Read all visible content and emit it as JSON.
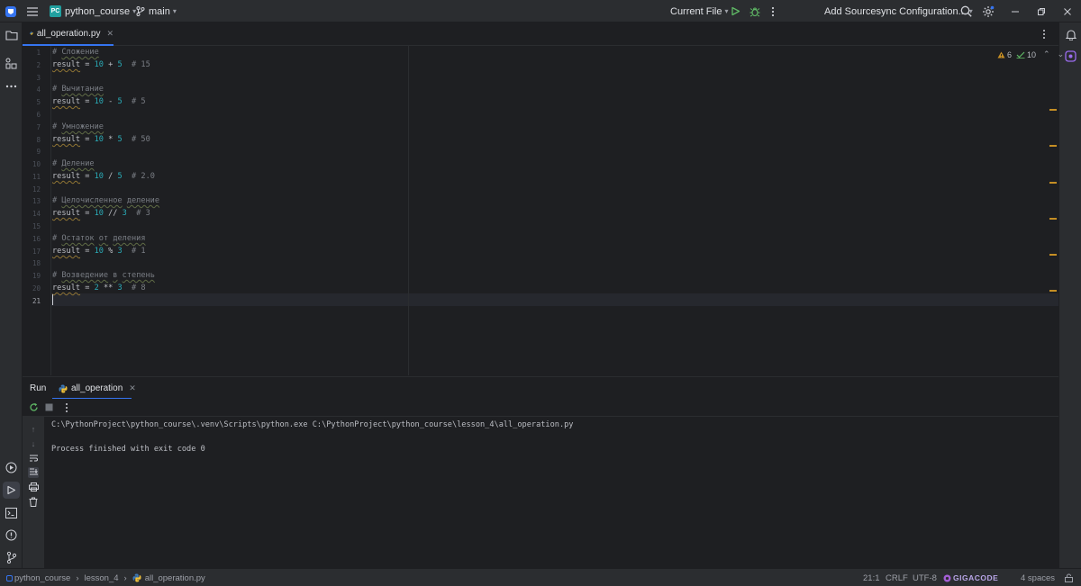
{
  "titlebar": {
    "project_badge": "PC",
    "project_name": "python_course",
    "branch": "main",
    "run_config": "Current File",
    "sourcesync": "Add Sourcesync Configuration..."
  },
  "editor_tab": {
    "filename": "all_operation.py"
  },
  "inspections": {
    "warnings": "6",
    "weak_warnings": "10"
  },
  "code_lines": [
    {
      "n": "1"
    },
    {
      "n": "2"
    },
    {
      "n": "3"
    },
    {
      "n": "4"
    },
    {
      "n": "5"
    },
    {
      "n": "6"
    },
    {
      "n": "7"
    },
    {
      "n": "8"
    },
    {
      "n": "9"
    },
    {
      "n": "10"
    },
    {
      "n": "11"
    },
    {
      "n": "12"
    },
    {
      "n": "13"
    },
    {
      "n": "14"
    },
    {
      "n": "15"
    },
    {
      "n": "16"
    },
    {
      "n": "17"
    },
    {
      "n": "18"
    },
    {
      "n": "19"
    },
    {
      "n": "20"
    },
    {
      "n": "21"
    }
  ],
  "code": {
    "c1": "Сложение",
    "c4": "Вычитание",
    "c7": "Умножение",
    "c10": "Деление",
    "c13a": "Целочисленное",
    "c13b": "деление",
    "c16a": "Остаток",
    "c16b": "от",
    "c16c": "деления",
    "c19a": "Возведение",
    "c19b": "в",
    "c19c": "степень",
    "var": "result",
    "add": {
      "a": "10",
      "op": "+",
      "b": "5",
      "res": "# 15"
    },
    "sub": {
      "a": "10",
      "op": "-",
      "b": "5",
      "res": "# 5"
    },
    "mul": {
      "a": "10",
      "op": "*",
      "b": "5",
      "res": "# 50"
    },
    "div": {
      "a": "10",
      "op": "/",
      "b": "5",
      "res": "# 2.0"
    },
    "fdiv": {
      "a": "10",
      "op": "//",
      "b": "3",
      "res": "# 3"
    },
    "mod": {
      "a": "10",
      "op": "%",
      "b": "3",
      "res": "# 1"
    },
    "pow": {
      "a": "2",
      "op": "**",
      "b": "3",
      "res": "# 8"
    }
  },
  "run_panel": {
    "title": "Run",
    "tab": "all_operation",
    "command": "C:\\PythonProject\\python_course\\.venv\\Scripts\\python.exe C:\\PythonProject\\python_course\\lesson_4\\all_operation.py",
    "exit_message": "Process finished with exit code 0"
  },
  "statusbar": {
    "crumb_project": "python_course",
    "crumb_folder": "lesson_4",
    "crumb_file": "all_operation.py",
    "position": "21:1",
    "line_sep": "CRLF",
    "encoding": "UTF-8",
    "plugin": "GIGACODE",
    "indent": "4 spaces"
  },
  "colors": {
    "accent": "#3574f0",
    "warning": "#c58e24",
    "number": "#2aacb8"
  }
}
